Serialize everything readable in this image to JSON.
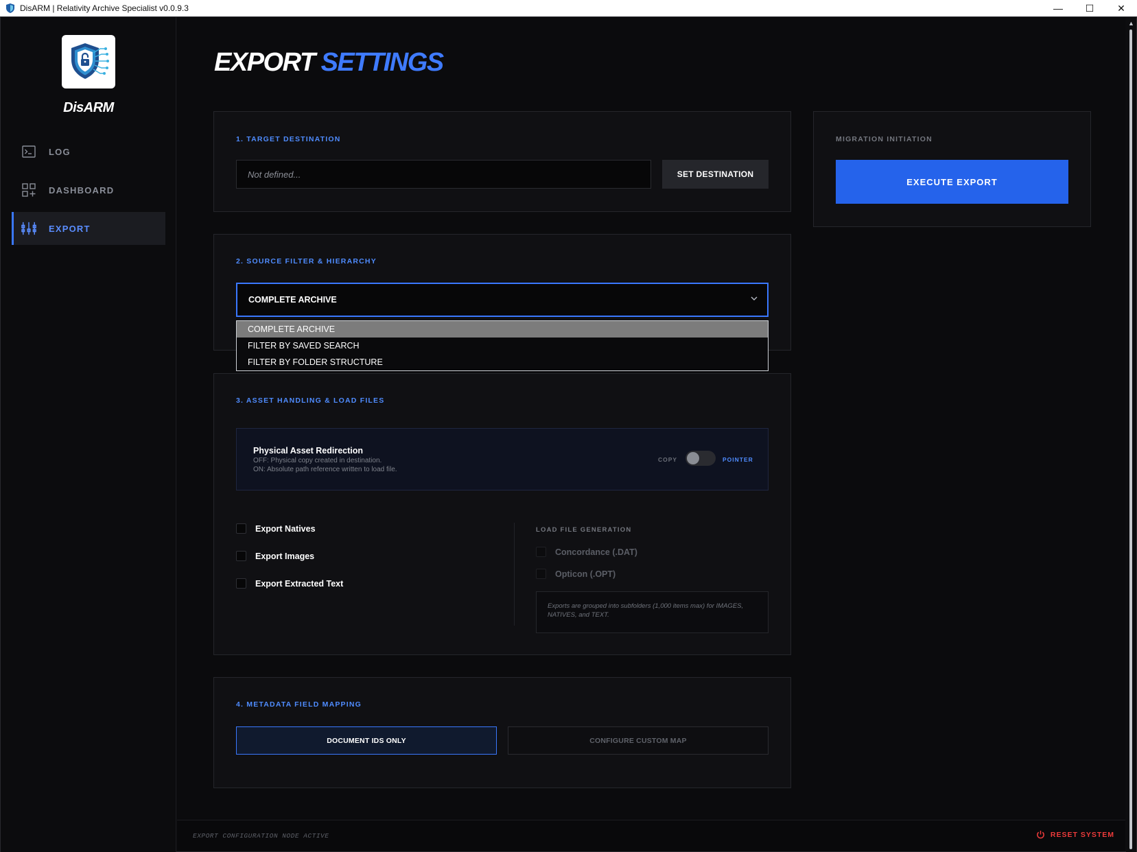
{
  "window": {
    "title": "DisARM | Relativity Archive Specialist v0.0.9.3",
    "controls": [
      "—",
      "☐",
      "✕"
    ]
  },
  "sidebar": {
    "brand": "DisARM",
    "items": [
      {
        "label": "LOG",
        "icon": "terminal-icon",
        "active": false
      },
      {
        "label": "DASHBOARD",
        "icon": "grid-add-icon",
        "active": false
      },
      {
        "label": "EXPORT",
        "icon": "sliders-icon",
        "active": true
      }
    ]
  },
  "page": {
    "title_part1": "EXPORT",
    "title_part2": "SETTINGS"
  },
  "target": {
    "title": "1. TARGET DESTINATION",
    "input_value": "Not defined...",
    "button": "SET DESTINATION"
  },
  "migration": {
    "title": "MIGRATION INITIATION",
    "button": "EXECUTE EXPORT"
  },
  "source": {
    "title": "2. SOURCE FILTER & HIERARCHY",
    "selected": "COMPLETE ARCHIVE",
    "options": [
      "COMPLETE ARCHIVE",
      "FILTER BY SAVED SEARCH",
      "FILTER BY FOLDER STRUCTURE"
    ]
  },
  "assets": {
    "title": "3. ASSET HANDLING & LOAD FILES",
    "redirection": {
      "title": "Physical Asset Redirection",
      "desc_off": "OFF: Physical copy created in destination.",
      "desc_on": "ON: Absolute path reference written to load file.",
      "left_label": "COPY",
      "right_label": "POINTER",
      "state": "off"
    },
    "exports": [
      {
        "label": "Export Natives",
        "checked": false
      },
      {
        "label": "Export Images",
        "checked": false
      },
      {
        "label": "Export Extracted Text",
        "checked": false
      }
    ],
    "load_files": {
      "title": "LOAD FILE GENERATION",
      "items": [
        {
          "label": "Concordance (.DAT)",
          "checked": false,
          "disabled": true
        },
        {
          "label": "Opticon (.OPT)",
          "checked": false,
          "disabled": true
        }
      ],
      "note": "Exports are grouped into subfolders (1,000 items max) for IMAGES, NATIVES, and TEXT."
    }
  },
  "metadata": {
    "title": "4. METADATA FIELD MAPPING",
    "option_active": "DOCUMENT IDS ONLY",
    "option_inactive": "CONFIGURE CUSTOM MAP"
  },
  "status": {
    "text": "EXPORT CONFIGURATION NODE ACTIVE",
    "reset": "RESET SYSTEM"
  },
  "colors": {
    "accent": "#3f7bff",
    "execute": "#2563eb",
    "danger": "#ef3b3b",
    "background": "#0b0b0d"
  }
}
